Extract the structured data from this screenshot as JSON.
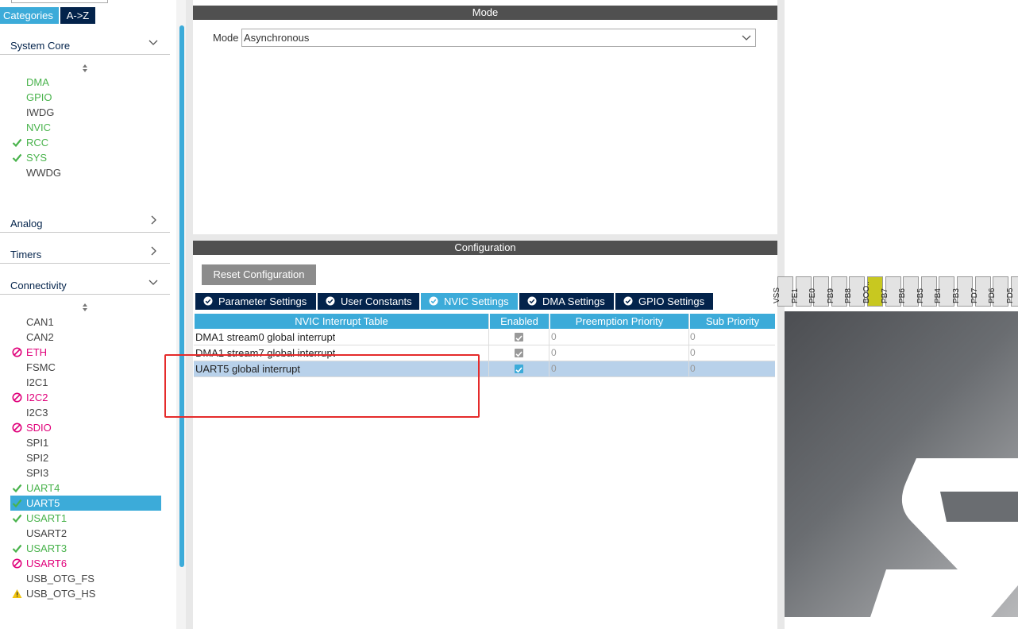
{
  "left_panel": {
    "tabs": {
      "categories": "Categories",
      "az": "A->Z"
    },
    "system_core": {
      "label": "System Core",
      "items": [
        {
          "label": "DMA",
          "status": "none",
          "color": "green"
        },
        {
          "label": "GPIO",
          "status": "none",
          "color": "green"
        },
        {
          "label": "IWDG",
          "status": "none",
          "color": "gray"
        },
        {
          "label": "NVIC",
          "status": "none",
          "color": "green"
        },
        {
          "label": "RCC",
          "status": "check",
          "color": "green"
        },
        {
          "label": "SYS",
          "status": "check",
          "color": "green"
        },
        {
          "label": "WWDG",
          "status": "none",
          "color": "gray"
        }
      ]
    },
    "analog": {
      "label": "Analog"
    },
    "timers": {
      "label": "Timers"
    },
    "connectivity": {
      "label": "Connectivity",
      "items": [
        {
          "label": "CAN1",
          "status": "none",
          "color": "gray"
        },
        {
          "label": "CAN2",
          "status": "none",
          "color": "gray"
        },
        {
          "label": "ETH",
          "status": "disabled",
          "color": "pink"
        },
        {
          "label": "FSMC",
          "status": "none",
          "color": "gray"
        },
        {
          "label": "I2C1",
          "status": "none",
          "color": "gray"
        },
        {
          "label": "I2C2",
          "status": "disabled",
          "color": "pink"
        },
        {
          "label": "I2C3",
          "status": "none",
          "color": "gray"
        },
        {
          "label": "SDIO",
          "status": "disabled",
          "color": "pink"
        },
        {
          "label": "SPI1",
          "status": "none",
          "color": "gray"
        },
        {
          "label": "SPI2",
          "status": "none",
          "color": "gray"
        },
        {
          "label": "SPI3",
          "status": "none",
          "color": "gray"
        },
        {
          "label": "UART4",
          "status": "check",
          "color": "green"
        },
        {
          "label": "UART5",
          "status": "check",
          "color": "white",
          "selected": true
        },
        {
          "label": "USART1",
          "status": "check",
          "color": "green"
        },
        {
          "label": "USART2",
          "status": "none",
          "color": "gray"
        },
        {
          "label": "USART3",
          "status": "check",
          "color": "green"
        },
        {
          "label": "USART6",
          "status": "disabled",
          "color": "pink"
        },
        {
          "label": "USB_OTG_FS",
          "status": "none",
          "color": "gray"
        },
        {
          "label": "USB_OTG_HS",
          "status": "warning",
          "color": "gray"
        }
      ]
    }
  },
  "mode_section": {
    "header": "Mode",
    "mode_label": "Mode",
    "mode_value": "Asynchronous"
  },
  "config_section": {
    "header": "Configuration",
    "reset_button": "Reset Configuration",
    "tabs": [
      {
        "label": "Parameter Settings",
        "active": false
      },
      {
        "label": "User Constants",
        "active": false
      },
      {
        "label": "NVIC Settings",
        "active": true
      },
      {
        "label": "DMA Settings",
        "active": false
      },
      {
        "label": "GPIO Settings",
        "active": false
      }
    ],
    "table": {
      "headers": [
        "NVIC Interrupt Table",
        "Enabled",
        "Preemption Priority",
        "Sub Priority"
      ],
      "rows": [
        {
          "name": "DMA1 stream0 global interrupt",
          "enabled": true,
          "enabled_editable": false,
          "preemption": "0",
          "sub": "0",
          "selected": false
        },
        {
          "name": "DMA1 stream7 global interrupt",
          "enabled": true,
          "enabled_editable": false,
          "preemption": "0",
          "sub": "0",
          "selected": false
        },
        {
          "name": "UART5 global interrupt",
          "enabled": true,
          "enabled_editable": true,
          "preemption": "0",
          "sub": "0",
          "selected": true
        }
      ]
    }
  },
  "chip_view": {
    "pins": [
      {
        "label": "VSS",
        "highlight": false
      },
      {
        "label": "PE1",
        "highlight": false
      },
      {
        "label": "PE0",
        "highlight": false
      },
      {
        "label": "PB9",
        "highlight": false
      },
      {
        "label": "PB8",
        "highlight": false
      },
      {
        "label": "BOO..",
        "highlight": true
      },
      {
        "label": "PB7",
        "highlight": false
      },
      {
        "label": "PB6",
        "highlight": false
      },
      {
        "label": "PB5",
        "highlight": false
      },
      {
        "label": "PB4",
        "highlight": false
      },
      {
        "label": "PB3",
        "highlight": false
      },
      {
        "label": "PD7",
        "highlight": false
      },
      {
        "label": "PD6",
        "highlight": false
      },
      {
        "label": "PD5",
        "highlight": false
      }
    ]
  },
  "colors": {
    "accent": "#3cabd9",
    "navy": "#03234b",
    "ok_green": "#49b34c",
    "disabled_pink": "#e0007a",
    "warning_yellow": "#f1c40f",
    "highlight_red": "#e52b2b"
  }
}
